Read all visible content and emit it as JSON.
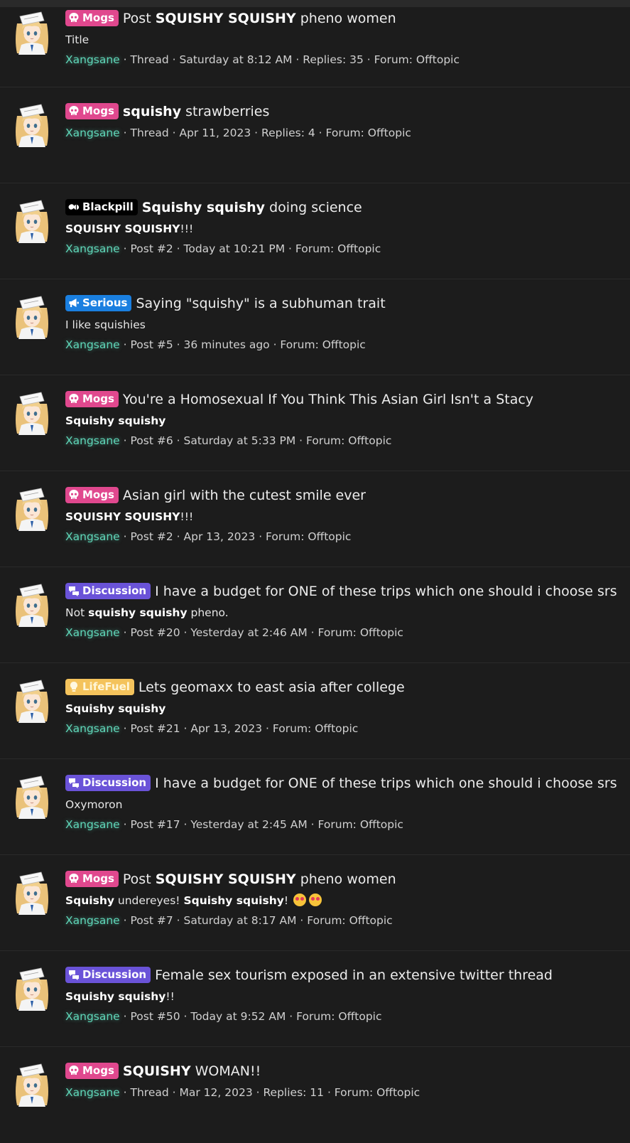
{
  "results": [
    {
      "label": "Mogs",
      "label_kind": "mogs",
      "label_icon": "skull-icon",
      "title": [
        {
          "t": "Post ",
          "b": false
        },
        {
          "t": "SQUISHY SQUISHY",
          "b": true
        },
        {
          "t": " pheno women",
          "b": false
        }
      ],
      "snippet": [
        {
          "t": "Title",
          "b": false
        }
      ],
      "author": "Xangsane",
      "type": "Thread",
      "date": "Saturday at 8:12 AM",
      "extra": "Replies: 35",
      "forum": "Forum: Offtopic"
    },
    {
      "label": "Mogs",
      "label_kind": "mogs",
      "label_icon": "skull-icon",
      "title": [
        {
          "t": "squishy",
          "b": true
        },
        {
          "t": " strawberries",
          "b": false
        }
      ],
      "snippet": [],
      "author": "Xangsane",
      "type": "Thread",
      "date": "Apr 11, 2023",
      "extra": "Replies: 4",
      "forum": "Forum: Offtopic"
    },
    {
      "label": "Blackpill",
      "label_kind": "blackpill",
      "label_icon": "pills-icon",
      "title": [
        {
          "t": "Squishy squishy",
          "b": true
        },
        {
          "t": " doing science",
          "b": false
        }
      ],
      "snippet": [
        {
          "t": "SQUISHY SQUISHY",
          "b": true
        },
        {
          "t": "!!!",
          "b": false
        }
      ],
      "author": "Xangsane",
      "type": "Post #2",
      "date": "Today at 10:21 PM",
      "extra": "",
      "forum": "Forum: Offtopic"
    },
    {
      "label": "Serious",
      "label_kind": "serious",
      "label_icon": "megaphone-icon",
      "title": [
        {
          "t": "Saying \"squishy\" is a subhuman trait",
          "b": false
        }
      ],
      "snippet": [
        {
          "t": "I like squishies",
          "b": false
        }
      ],
      "author": "Xangsane",
      "type": "Post #5",
      "date": "36 minutes ago",
      "extra": "",
      "forum": "Forum: Offtopic"
    },
    {
      "label": "Mogs",
      "label_kind": "mogs",
      "label_icon": "skull-icon",
      "title": [
        {
          "t": "You're a Homosexual If You Think This Asian Girl Isn't a Stacy",
          "b": false
        }
      ],
      "snippet": [
        {
          "t": "Squishy squishy",
          "b": true
        }
      ],
      "author": "Xangsane",
      "type": "Post #6",
      "date": "Saturday at 5:33 PM",
      "extra": "",
      "forum": "Forum: Offtopic"
    },
    {
      "label": "Mogs",
      "label_kind": "mogs",
      "label_icon": "skull-icon",
      "title": [
        {
          "t": "Asian girl with the cutest smile ever",
          "b": false
        }
      ],
      "snippet": [
        {
          "t": "SQUISHY SQUISHY",
          "b": true
        },
        {
          "t": "!!!",
          "b": false
        }
      ],
      "author": "Xangsane",
      "type": "Post #2",
      "date": "Apr 13, 2023",
      "extra": "",
      "forum": "Forum: Offtopic"
    },
    {
      "label": "Discussion",
      "label_kind": "discussion",
      "label_icon": "chat-bubbles-icon",
      "title": [
        {
          "t": "I have a budget for ONE of these trips which one should i choose srs",
          "b": false
        }
      ],
      "snippet": [
        {
          "t": "Not ",
          "b": false
        },
        {
          "t": "squishy squishy",
          "b": true
        },
        {
          "t": " pheno.",
          "b": false
        }
      ],
      "author": "Xangsane",
      "type": "Post #20",
      "date": "Yesterday at 2:46 AM",
      "extra": "",
      "forum": "Forum: Offtopic"
    },
    {
      "label": "LifeFuel",
      "label_kind": "lifefuel",
      "label_icon": "lightbulb-icon",
      "title": [
        {
          "t": "Lets geomaxx to east asia after college",
          "b": false
        }
      ],
      "snippet": [
        {
          "t": "Squishy squishy",
          "b": true
        }
      ],
      "author": "Xangsane",
      "type": "Post #21",
      "date": "Apr 13, 2023",
      "extra": "",
      "forum": "Forum: Offtopic"
    },
    {
      "label": "Discussion",
      "label_kind": "discussion",
      "label_icon": "chat-bubbles-icon",
      "title": [
        {
          "t": "I have a budget for ONE of these trips which one should i choose srs",
          "b": false
        }
      ],
      "snippet": [
        {
          "t": "Oxymoron",
          "b": false
        }
      ],
      "author": "Xangsane",
      "type": "Post #17",
      "date": "Yesterday at 2:45 AM",
      "extra": "",
      "forum": "Forum: Offtopic"
    },
    {
      "label": "Mogs",
      "label_kind": "mogs",
      "label_icon": "skull-icon",
      "title": [
        {
          "t": "Post ",
          "b": false
        },
        {
          "t": "SQUISHY SQUISHY",
          "b": true
        },
        {
          "t": " pheno women",
          "b": false
        }
      ],
      "snippet": [
        {
          "t": "Squishy",
          "b": true
        },
        {
          "t": " undereyes! ",
          "b": false
        },
        {
          "t": "Squishy squishy",
          "b": true
        },
        {
          "t": "! ",
          "b": false
        },
        {
          "emoji": "heart-eyes-emoji"
        },
        {
          "emoji": "heart-eyes-emoji"
        }
      ],
      "author": "Xangsane",
      "type": "Post #7",
      "date": "Saturday at 8:17 AM",
      "extra": "",
      "forum": "Forum: Offtopic"
    },
    {
      "label": "Discussion",
      "label_kind": "discussion",
      "label_icon": "chat-bubbles-icon",
      "title": [
        {
          "t": "Female sex tourism exposed in an extensive twitter thread",
          "b": false
        }
      ],
      "snippet": [
        {
          "t": "Squishy squishy",
          "b": true
        },
        {
          "t": "!!",
          "b": false
        }
      ],
      "author": "Xangsane",
      "type": "Post #50",
      "date": "Today at 9:52 AM",
      "extra": "",
      "forum": "Forum: Offtopic"
    },
    {
      "label": "Mogs",
      "label_kind": "mogs",
      "label_icon": "skull-icon",
      "title": [
        {
          "t": "SQUISHY",
          "b": true
        },
        {
          "t": " WOMAN!!",
          "b": false
        }
      ],
      "snippet": [],
      "author": "Xangsane",
      "type": "Thread",
      "date": "Mar 12, 2023",
      "extra": "Replies: 11",
      "forum": "Forum: Offtopic"
    }
  ]
}
